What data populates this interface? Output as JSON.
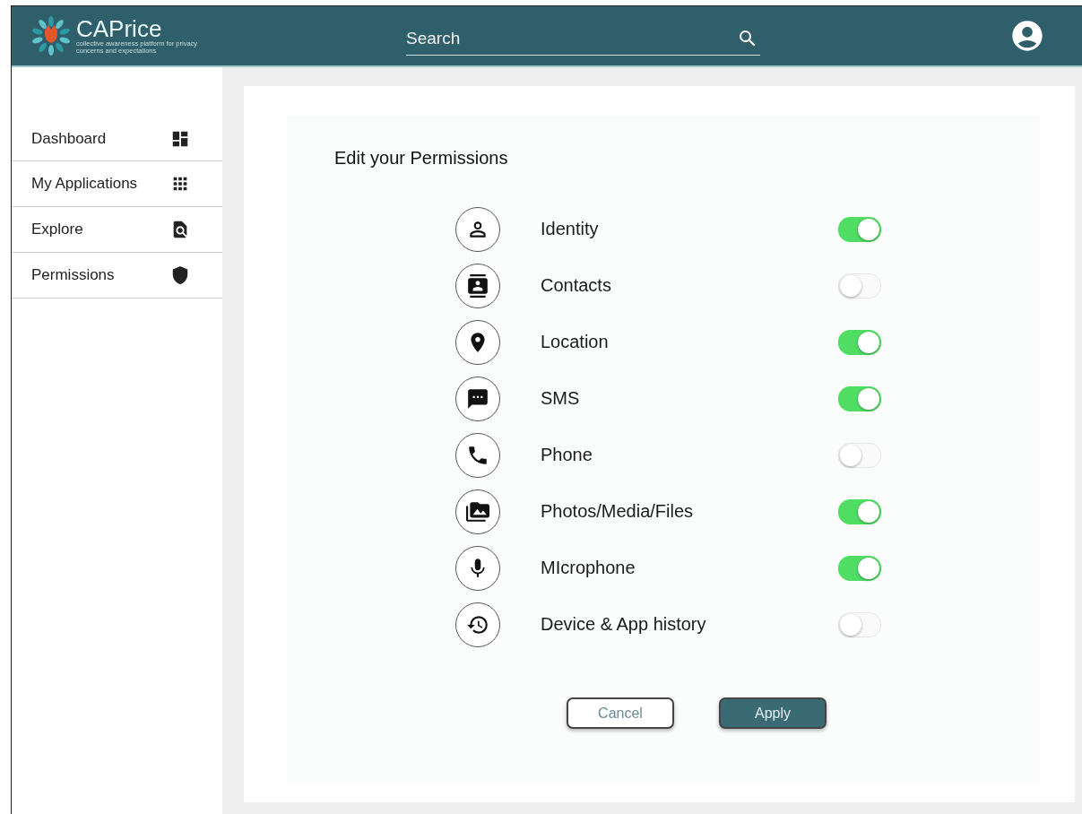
{
  "header": {
    "logo_title": "CAPrice",
    "logo_subtitle": "collective awareness platform for privacy concerns and expectations",
    "search": {
      "placeholder": "Search"
    }
  },
  "sidebar": {
    "items": [
      {
        "label": "Dashboard",
        "selected": false
      },
      {
        "label": "My Applications",
        "selected": false
      },
      {
        "label": "Explore",
        "selected": false
      },
      {
        "label": "Permissions",
        "selected": false
      }
    ]
  },
  "panel": {
    "title": "Edit your Permissions",
    "permissions": [
      {
        "label": "Identity",
        "on": true
      },
      {
        "label": "Contacts",
        "on": false
      },
      {
        "label": "Location",
        "on": true
      },
      {
        "label": "SMS",
        "on": true
      },
      {
        "label": "Phone",
        "on": false
      },
      {
        "label": "Photos/Media/Files",
        "on": true
      },
      {
        "label": "MIcrophone",
        "on": true
      },
      {
        "label": "Device & App history",
        "on": false
      }
    ],
    "buttons": [
      {
        "label": "Cancel",
        "kind": "secondary"
      },
      {
        "label": "Apply",
        "kind": "primary"
      }
    ]
  }
}
